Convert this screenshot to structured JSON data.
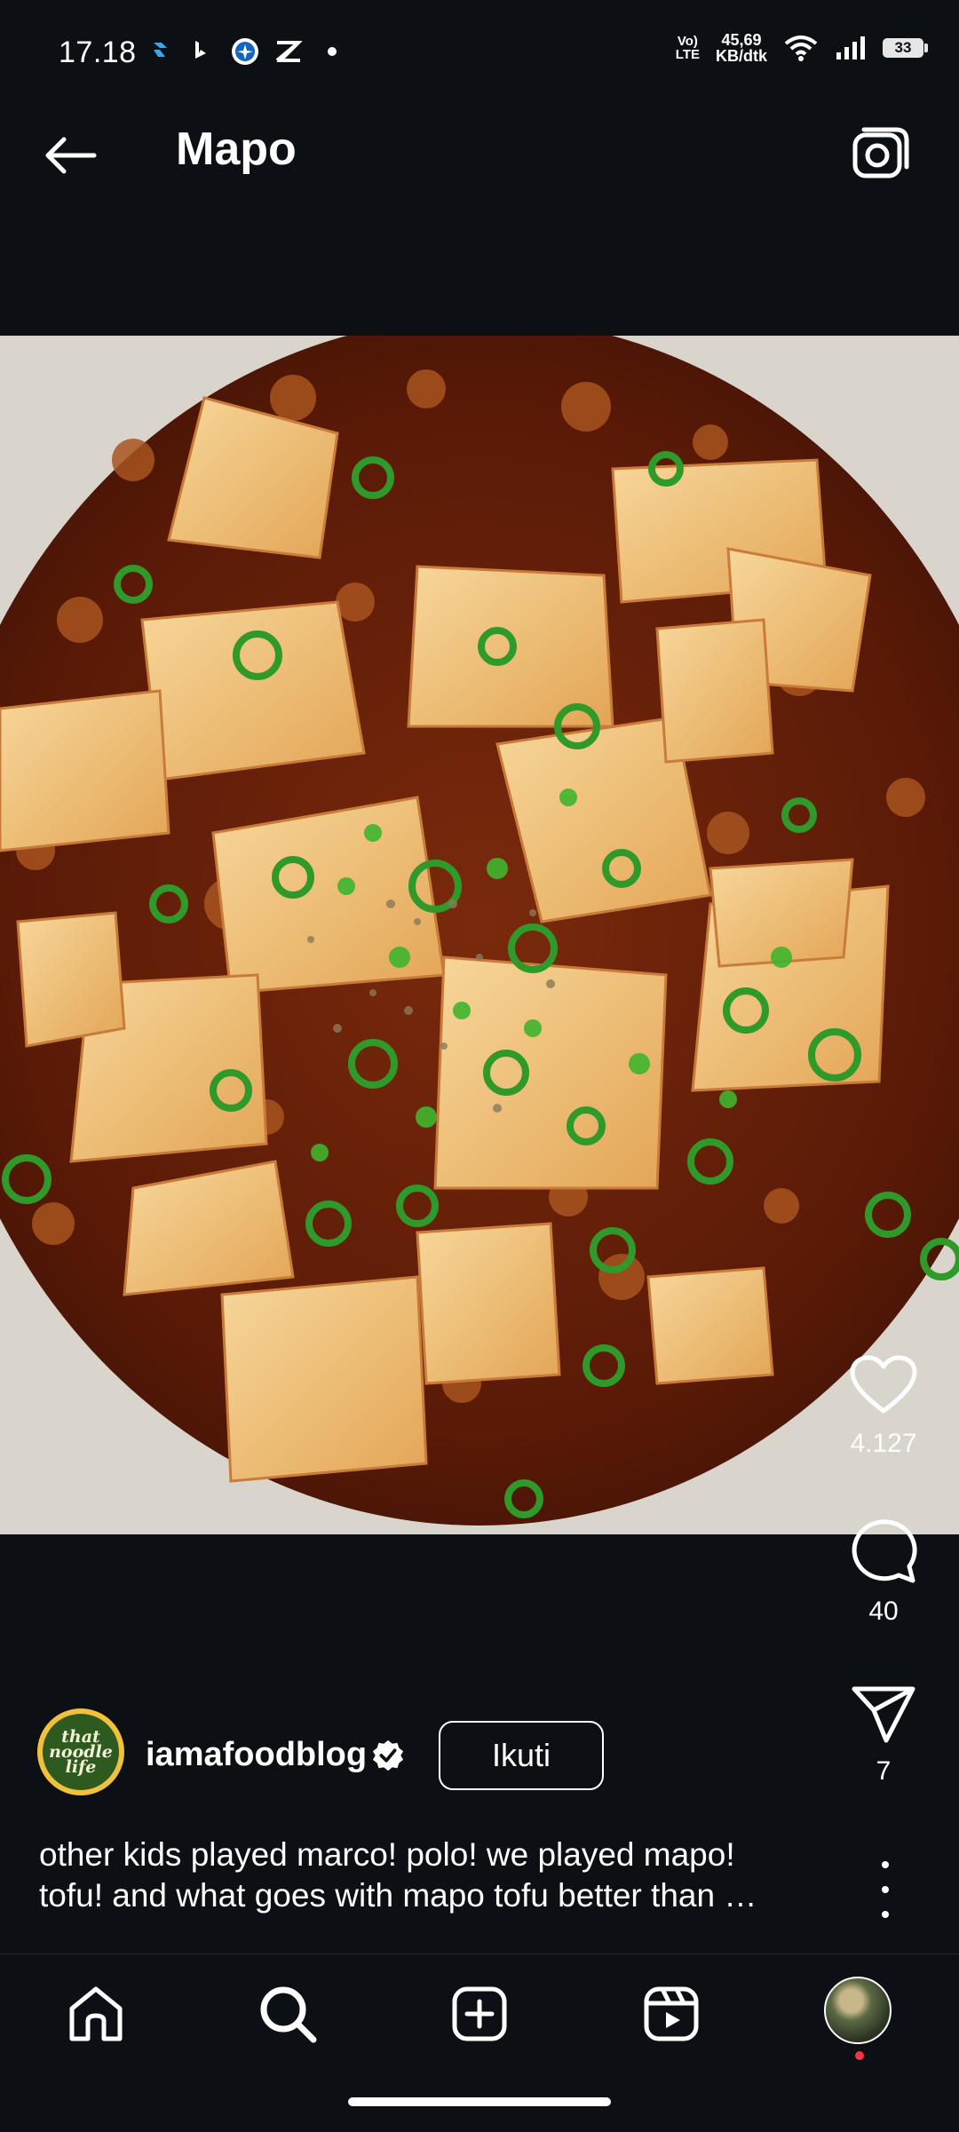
{
  "status_bar": {
    "time": "17.18",
    "volte": "Vo)\nLTE",
    "net_speed_value": "45,69",
    "net_speed_unit": "KB/dtk",
    "battery": "33",
    "icons": [
      "reel-icon",
      "bing-icon",
      "compass-app-icon",
      "capcut-icon",
      "dot-icon",
      "wifi-icon",
      "signal-icon",
      "battery-icon"
    ]
  },
  "header": {
    "title": "Mapo",
    "back_icon": "arrow-left-icon",
    "camera_icon": "camera-icon"
  },
  "post": {
    "image_description_icon": "food-photo",
    "likes": "4.127",
    "comments": "40",
    "shares": "7",
    "author": {
      "username": "iamafoodblog",
      "avatar_text": "that\nnoodle\nlife",
      "verified": true
    },
    "follow_label": "Ikuti",
    "caption": "other kids played marco! polo! we played mapo!\ntofu! and what goes with mapo tofu better than …"
  },
  "bottom_nav": {
    "items": [
      "home-icon",
      "search-icon",
      "create-icon",
      "reels-icon",
      "profile-icon"
    ]
  },
  "colors": {
    "background": "#0c1014",
    "text": "#ffffff",
    "notification_dot": "#ff3040",
    "sauce": "#6a1f0a",
    "tofu": "#f0c06a",
    "scallion": "#2f9a2a"
  }
}
